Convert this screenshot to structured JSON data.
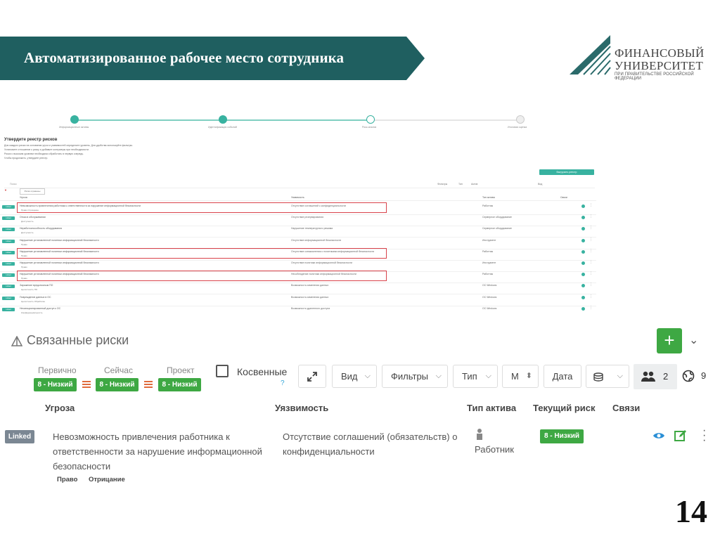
{
  "slide": {
    "title": "Автоматизированное рабочее место сотрудника",
    "page_number": "14"
  },
  "logo": {
    "line1": "ФИНАНСОВЫЙ",
    "line2": "УНИВЕРСИТЕТ",
    "line3": "ПРИ ПРАВИТЕЛЬСТВЕ РОССИЙСКОЙ ФЕДЕРАЦИИ"
  },
  "shot": {
    "steps": [
      "Информационные активы",
      "Идентификация событий",
      "Риск-анализ",
      "Итоговая оценка"
    ],
    "heading": "Утвердите реестр рисков",
    "lines": [
      "Для каждого риска на основании угроз и уязвимостей определите уровень. Для удобства используйте фильтры.",
      "Установите отношение к риску и добавьте контрмеры при необходимости.",
      "Риски с высоким уровнем необходимо обработать в первую очередь.",
      "Чтобы продолжить, утвердите реестр."
    ],
    "button": "Выгрузить реестр",
    "search_label": "Поиск",
    "toolbar": [
      "Фильтры",
      "Тип",
      "Актив",
      "Вид"
    ],
    "chip": "Риски отражены",
    "head": [
      "Угроза",
      "Уязвимость",
      "Тип актива",
      "Связи"
    ],
    "rows": [
      {
        "t1": "Невозможность привлечения работника к ответственности за нарушение информационной безопасности",
        "t2": "Право  Отрицание",
        "v": "Отсутствие соглашений о конфиденциальности",
        "a": "Работник",
        "boxed": true
      },
      {
        "t1": "Отказ в обслуживании",
        "t2": "Доступность",
        "v": "Отсутствие резервирования",
        "a": "Серверное оборудование",
        "boxed": false
      },
      {
        "t1": "Неработоспособность оборудования",
        "t2": "Доступность",
        "v": "Нарушение температурного режима",
        "a": "Серверное оборудование",
        "boxed": false
      },
      {
        "t1": "Нарушение установленной политики информационной безопасности",
        "t2": "Право",
        "v": "Отсутствие информационной безопасности",
        "a": "Инструмент",
        "boxed": false
      },
      {
        "t1": "Нарушение установленной политики информационной безопасности",
        "t2": "Право",
        "v": "Отсутствие ознакомления с политиками информационной безопасности",
        "a": "Работник",
        "boxed": true
      },
      {
        "t1": "Нарушение установленной политики информационной безопасности",
        "t2": "Право",
        "v": "Отсутствие политики информационной безопасности",
        "a": "Инструмент",
        "boxed": false
      },
      {
        "t1": "Нарушение установленной политики информационной безопасности",
        "t2": "Право",
        "v": "Несоблюдение политики информационной безопасности",
        "a": "Работник",
        "boxed": true
      },
      {
        "t1": "Заражение вредоносным ПО",
        "t2": "Целостность  ПО",
        "v": "Возможность изменения данных",
        "a": "ОС Windows",
        "boxed": false
      },
      {
        "t1": "Повреждение данных в ОС",
        "t2": "Целостность  Обработка",
        "v": "Возможность изменения данных",
        "a": "ОС Windows",
        "boxed": false
      },
      {
        "t1": "Несанкционированный доступ к ОС",
        "t2": "Конфиденциальность",
        "v": "Возможность удаленного доступа",
        "a": "ОС Windows",
        "boxed": false
      }
    ]
  },
  "panel": {
    "title": "Связанные риски",
    "levels": [
      {
        "label": "Первично",
        "value": "8 - Низкий"
      },
      {
        "label": "Сейчас",
        "value": "8 - Низкий"
      },
      {
        "label": "Проект",
        "value": "8 - Низкий"
      }
    ],
    "indirect_label": "Косвенные",
    "help": "?",
    "toolbar": {
      "view": "Вид",
      "filters": "Фильтры",
      "type": "Тип",
      "m": "М",
      "date": "Дата",
      "group_count": "2",
      "globe_count": "9"
    },
    "columns": {
      "threat": "Угроза",
      "vuln": "Уязвимость",
      "asset_type": "Тип актива",
      "current_risk": "Текущий риск",
      "links": "Связи"
    },
    "row": {
      "status": "Linked",
      "threat": "Невозможность привлечения работника к ответственности за нарушение информационной безопасности",
      "tags": [
        "Право",
        "Отрицание"
      ],
      "vuln": "Отсутствие соглашений (обязательств) о конфиденциальности",
      "asset": "Работник",
      "risk": "8 - Низкий"
    }
  },
  "colors": {
    "banner": "#1f5f60",
    "green": "#3ea843",
    "teal": "#38b2a0",
    "highlight": "#d9434b"
  }
}
